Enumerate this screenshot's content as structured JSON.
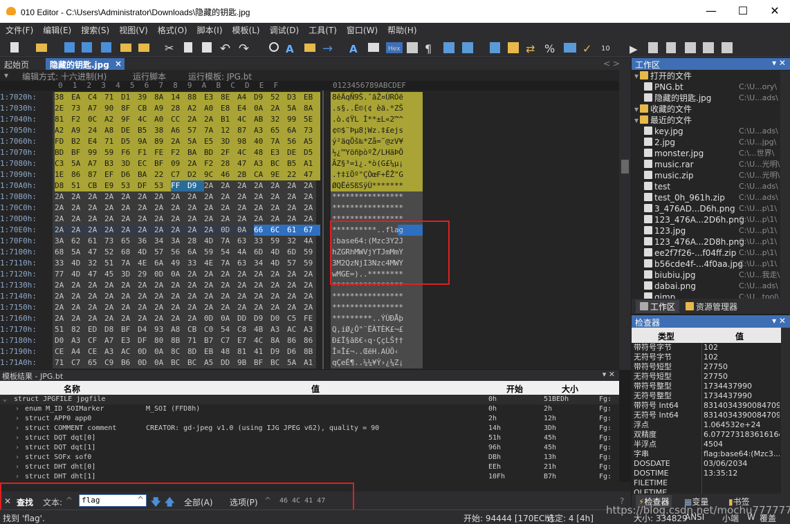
{
  "window": {
    "title": "010 Editor - C:\\Users\\Administrator\\Downloads\\隐藏的钥匙.jpg",
    "minimize": "—",
    "maximize": "☐",
    "close": "✕"
  },
  "menu": [
    "文件(F)",
    "编辑(E)",
    "搜索(S)",
    "视图(V)",
    "格式(O)",
    "脚本(I)",
    "模板(L)",
    "调试(D)",
    "工具(T)",
    "窗口(W)",
    "帮助(H)"
  ],
  "tabs": {
    "start": "起始页",
    "file": "隐藏的钥匙.jpg",
    "close": "×"
  },
  "editor_header": {
    "edit_mode": "编辑方式: 十六进制(H)",
    "run_script": "运行脚本",
    "run_template": "运行模板: JPG.bt"
  },
  "column_header": {
    "hex": "0  1  2  3  4  5  6  7  8  9  A  B  C  D  E  F",
    "ascii": "0123456789ABCDEF"
  },
  "hex_rows": [
    {
      "addr": "1:7020h:",
      "bytes": "38 EA C4 71 D1 39 8A 14 88 E3 8E A4 D9 52 D3 EB",
      "ascii": "8êÄqÑ9Š.ˆãŽ¤ÙRÓë"
    },
    {
      "addr": "1:7030h:",
      "bytes": "2E 73 A7 90 8F CB A9 28 A2 A0 E8 E4 0A 2A 5A 8A",
      "ascii": ".s§..Ë©(¢ èä.*ZŠ"
    },
    {
      "addr": "1:7040h:",
      "bytes": "81 F2 0C A2 9F 4C A0 CC 2A 2A B1 4C AB 32 99 5E",
      "ascii": ".ò.¢ŸL Ì**±L«2™^"
    },
    {
      "addr": "1:7050h:",
      "bytes": "A2 A9 24 A8 DE B5 38 A6 57 7A 12 87 A3 65 6A 73",
      "ascii": "¢©$¨Þµ8¦Wz.‡£ejs"
    },
    {
      "addr": "1:7060h:",
      "bytes": "FD B2 E4 71 D5 9A 89 2A 5A E5 3D 98 40 7A 56 A5",
      "ascii": "ý²äqÕš‰*Zå=˜@zV¥"
    },
    {
      "addr": "1:7070h:",
      "bytes": "BD BF 99 59 F6 F1 FE F2 BA BD 2F 4C 48 E3 DE D5",
      "ascii": "½¿™YöñþòºŽ/LHãÞÕ"
    },
    {
      "addr": "1:7080h:",
      "bytes": "C3 5A A7 B3 3D EC BF 09 2A F2 28 47 A3 BC B5 A1",
      "ascii": "ÃZ§³=ì¿.*ò(G£¼µ¡"
    },
    {
      "addr": "1:7090h:",
      "bytes": "1E 86 87 EF D6 BA 22 C7 D2 9C 46 2B CA 9E 22 47",
      "ascii": ".†‡ïÖº\"ÇÒœF+ÊŽ\"G"
    },
    {
      "addr": "1:70A0h:",
      "bytes": "D8 51 CB E9 53 DF 53 FF D9 2A 2A 2A 2A 2A 2A 2A",
      "ascii": "ØQËéSßSÿÙ*******"
    },
    {
      "addr": "1:70B0h:",
      "bytes": "2A 2A 2A 2A 2A 2A 2A 2A 2A 2A 2A 2A 2A 2A 2A 2A",
      "ascii": "****************"
    },
    {
      "addr": "1:70C0h:",
      "bytes": "2A 2A 2A 2A 2A 2A 2A 2A 2A 2A 2A 2A 2A 2A 2A 2A",
      "ascii": "****************"
    },
    {
      "addr": "1:70D0h:",
      "bytes": "2A 2A 2A 2A 2A 2A 2A 2A 2A 2A 2A 2A 2A 2A 2A 2A",
      "ascii": "****************"
    },
    {
      "addr": "1:70E0h:",
      "bytes": "2A 2A 2A 2A 2A 2A 2A 2A 2A 2A 0D 0A 66 6C 61 67",
      "ascii": "**********..flag"
    },
    {
      "addr": "1:70F0h:",
      "bytes": "3A 62 61 73 65 36 34 3A 28 4D 7A 63 33 59 32 4A",
      "ascii": ":base64:(Mzc3Y2J"
    },
    {
      "addr": "1:7100h:",
      "bytes": "68 5A 47 52 68 4D 57 56 6A 59 54 4A 6D 4D 6D 59",
      "ascii": "hZGRhMWVjYTJmMmY"
    },
    {
      "addr": "1:7110h:",
      "bytes": "33 4D 32 51 7A 4E 6A 49 33 4E 7A 63 34 4D 57 59",
      "ascii": "3M2QzNjI3Nzc4MWY"
    },
    {
      "addr": "1:7120h:",
      "bytes": "77 4D 47 45 3D 29 0D 0A 2A 2A 2A 2A 2A 2A 2A 2A",
      "ascii": "wMGE=)..********"
    },
    {
      "addr": "1:7130h:",
      "bytes": "2A 2A 2A 2A 2A 2A 2A 2A 2A 2A 2A 2A 2A 2A 2A 2A",
      "ascii": "****************"
    },
    {
      "addr": "1:7140h:",
      "bytes": "2A 2A 2A 2A 2A 2A 2A 2A 2A 2A 2A 2A 2A 2A 2A 2A",
      "ascii": "****************"
    },
    {
      "addr": "1:7150h:",
      "bytes": "2A 2A 2A 2A 2A 2A 2A 2A 2A 2A 2A 2A 2A 2A 2A 2A",
      "ascii": "****************"
    },
    {
      "addr": "1:7160h:",
      "bytes": "2A 2A 2A 2A 2A 2A 2A 2A 2A 0D 0A DD D9 D0 C5 FE",
      "ascii": "*********..ÝÙÐÅþ"
    },
    {
      "addr": "1:7170h:",
      "bytes": "51 82 ED D8 BF D4 93 A8 CB C0 54 C8 4B A3 AC A3",
      "ascii": "Q,íØ¿Ô\"¨ËÀTÈK£¬£"
    },
    {
      "addr": "1:7180h:",
      "bytes": "D0 A3 CF A7 E3 DF 80 8B 71 B7 C7 E7 4C 8A 86 86",
      "ascii": "Ð£Ï§ãß€‹q·ÇçLŠ††"
    },
    {
      "addr": "1:7190h:",
      "bytes": "CE A4 CE A3 AC 0D 0A 8C 8D EB 48 81 41 D9 D6 8B",
      "ascii": "Î¤Î£¬..ŒëH.AÙÖ‹"
    },
    {
      "addr": "1:71A0h:",
      "bytes": "71 C7 65 C9 B6 0D 0A BC BC A5 DD 9B BF BC 5A A1",
      "ascii": "qÇeÉ¶..¼¼¥Ý›¿¼Z¡"
    }
  ],
  "workspace": {
    "title": "工作区",
    "open_files_label": "打开的文件",
    "open_files": [
      {
        "name": "PNG.bt",
        "path": "C:\\U...ory\\"
      },
      {
        "name": "隐藏的钥匙.jpg",
        "path": "C:\\U...ads\\"
      }
    ],
    "favorites_label": "收藏的文件",
    "recent_label": "最近的文件",
    "recent": [
      {
        "name": "key.jpg",
        "path": "C:\\U...ads\\"
      },
      {
        "name": "2.jpg",
        "path": "C:\\U...jpg\\"
      },
      {
        "name": "monster.jpg",
        "path": "C:\\...世界\\"
      },
      {
        "name": "music.rar",
        "path": "C:\\U...光明\\"
      },
      {
        "name": "music.zip",
        "path": "C:\\U...光明\\"
      },
      {
        "name": "test",
        "path": "C:\\U...ads\\"
      },
      {
        "name": "test_0h_961h.zip",
        "path": "C:\\U...ads\\"
      },
      {
        "name": "3_476AD...D6h.png",
        "path": "C:\\U...p\\1\\"
      },
      {
        "name": "123_476A...2D6h.png",
        "path": "C:\\U...p\\1\\"
      },
      {
        "name": "123.jpg",
        "path": "C:\\U...p\\1\\"
      },
      {
        "name": "123_476A...2D8h.png",
        "path": "C:\\U...p\\1\\"
      },
      {
        "name": "ee2f7f26-...f04ff.zip",
        "path": "C:\\U...p\\1\\"
      },
      {
        "name": "b56cde4f-...4f0aa.jpg",
        "path": "C:\\U...p\\1\\"
      },
      {
        "name": "biubiu.jpg",
        "path": "C:\\U...我走\\"
      },
      {
        "name": "dabai.png",
        "path": "C:\\U...ads\\"
      },
      {
        "name": "gimp",
        "path": "C:\\U...tool\\"
      }
    ],
    "tab_workspace": "工作区",
    "tab_explorer": "资源管理器"
  },
  "inspector": {
    "title": "检查器",
    "col_type": "类型",
    "col_value": "值",
    "rows": [
      {
        "k": "带符号字节",
        "v": "102"
      },
      {
        "k": "无符号字节",
        "v": "102"
      },
      {
        "k": "带符号短型",
        "v": "27750"
      },
      {
        "k": "无符号短型",
        "v": "27750"
      },
      {
        "k": "带符号整型",
        "v": "1734437990"
      },
      {
        "k": "无符号整型",
        "v": "1734437990"
      },
      {
        "k": "带符号 Int64",
        "v": "8314034390084709..."
      },
      {
        "k": "无符号 Int64",
        "v": "8314034390084709..."
      },
      {
        "k": "浮点",
        "v": "1.064532e+24"
      },
      {
        "k": "双精度",
        "v": "6.07727318361616e..."
      },
      {
        "k": "半浮点",
        "v": "4504"
      },
      {
        "k": "字串",
        "v": "flag:base64:(Mzc3..."
      },
      {
        "k": "DOSDATE",
        "v": "03/06/2034"
      },
      {
        "k": "DOSTIME",
        "v": "13:35:12"
      },
      {
        "k": "FILETIME",
        "v": ""
      },
      {
        "k": "OLETIME",
        "v": ""
      }
    ],
    "tab_inspector": "检查器",
    "tab_vars": "变量",
    "tab_bookmarks": "书签"
  },
  "template": {
    "title": "模板结果 - JPG.bt",
    "cols": {
      "name": "名称",
      "value": "值",
      "start": "开始",
      "size": "大小"
    },
    "rows": [
      {
        "name": "struct JPGFILE jpgfile",
        "value": "",
        "start": "0h",
        "size": "51BEDh",
        "c": "Fg:"
      },
      {
        "name": "  enum M_ID SOIMarker",
        "value": "M_SOI (FFD8h)",
        "start": "0h",
        "size": "2h",
        "c": "Fg:"
      },
      {
        "name": "  struct APP0 app0",
        "value": "",
        "start": "2h",
        "size": "12h",
        "c": "Fg:"
      },
      {
        "name": "  struct COMMENT comment",
        "value": "CREATOR: gd-jpeg v1.0 (using IJG JPEG v62), quality = 90",
        "start": "14h",
        "size": "3Dh",
        "c": "Fg:"
      },
      {
        "name": "  struct DQT dqt[0]",
        "value": "",
        "start": "51h",
        "size": "45h",
        "c": "Fg:"
      },
      {
        "name": "  struct DQT dqt[1]",
        "value": "",
        "start": "96h",
        "size": "45h",
        "c": "Fg:"
      },
      {
        "name": "  struct SOFx sof0",
        "value": "",
        "start": "DBh",
        "size": "13h",
        "c": "Fg:"
      },
      {
        "name": "  struct DHT dht[0]",
        "value": "",
        "start": "EEh",
        "size": "21h",
        "c": "Fg:"
      },
      {
        "name": "  struct DHT dht[1]",
        "value": "",
        "start": "10Fh",
        "size": "B7h",
        "c": "Fg:"
      }
    ]
  },
  "find": {
    "close": "✕",
    "label": "查找",
    "type_label": "文本:",
    "query": "flag",
    "all_button": "全部(A)",
    "options_button": "选项(P)",
    "hex_preview": "46 4C 41 47",
    "help": "?"
  },
  "status": {
    "message": "找到 'flag'.",
    "start": "开始: 94444 [170ECh]",
    "selected": "选定: 4 [4h]",
    "size": "大小: 334829",
    "encoding": "ANSI",
    "endian": "小端",
    "w": "W",
    "mode": "覆盖"
  },
  "watermark": "https://blog.csdn.net/mochu7777777"
}
